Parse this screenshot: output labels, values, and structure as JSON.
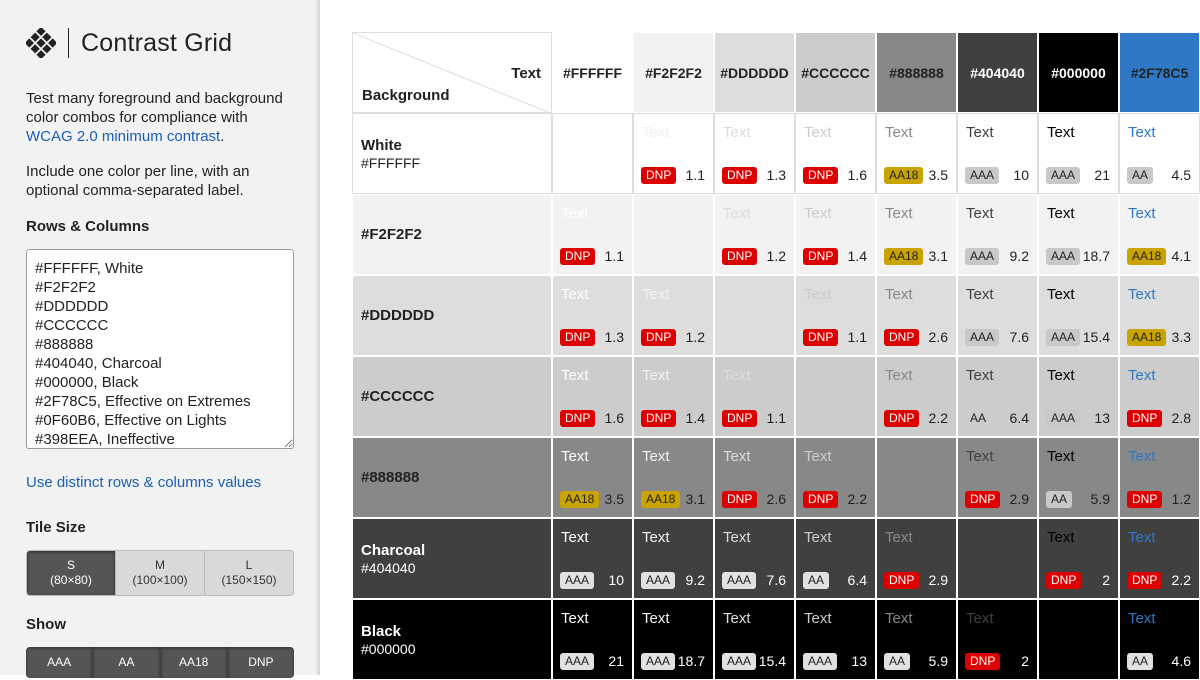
{
  "app": {
    "title": "Contrast Grid",
    "intro_text": "Test many foreground and background color combos for compliance with ",
    "intro_link": "WCAG 2.0 minimum contrast",
    "intro_end": ".",
    "note": "Include one color per line, with an optional comma-separated label."
  },
  "controls": {
    "rows_label": "Rows & Columns",
    "rows_value": "#FFFFFF, White\n#F2F2F2\n#DDDDDD\n#CCCCCC\n#888888\n#404040, Charcoal\n#000000, Black\n#2F78C5, Effective on Extremes\n#0F60B6, Effective on Lights\n#398EEA, Ineffective",
    "distinct_link": "Use distinct rows & columns values",
    "tile_size_label": "Tile Size",
    "tile_sizes": [
      {
        "name": "S",
        "dim": "(80×80)",
        "active": true
      },
      {
        "name": "M",
        "dim": "(100×100)",
        "active": false
      },
      {
        "name": "L",
        "dim": "(150×150)",
        "active": false
      }
    ],
    "show_label": "Show",
    "show_options": [
      "AAA",
      "AA",
      "AA18",
      "DNP"
    ]
  },
  "grid": {
    "corner_text": "Text",
    "corner_bg": "Background",
    "sample_text": "Text",
    "columns": [
      {
        "hex": "#FFFFFF"
      },
      {
        "hex": "#F2F2F2"
      },
      {
        "hex": "#DDDDDD"
      },
      {
        "hex": "#CCCCCC"
      },
      {
        "hex": "#888888"
      },
      {
        "hex": "#404040"
      },
      {
        "hex": "#000000"
      },
      {
        "hex": "#2F78C5"
      }
    ],
    "rows": [
      {
        "label": "White",
        "hex": "#FFFFFF",
        "show_hex": true
      },
      {
        "label": "",
        "hex": "#F2F2F2",
        "show_hex": false
      },
      {
        "label": "",
        "hex": "#DDDDDD",
        "show_hex": false
      },
      {
        "label": "",
        "hex": "#CCCCCC",
        "show_hex": false
      },
      {
        "label": "",
        "hex": "#888888",
        "show_hex": false
      },
      {
        "label": "Charcoal",
        "hex": "#404040",
        "show_hex": true
      },
      {
        "label": "Black",
        "hex": "#000000",
        "show_hex": true
      }
    ],
    "cells": [
      [
        null,
        {
          "badge": "DNP",
          "ratio": "1.1"
        },
        {
          "badge": "DNP",
          "ratio": "1.3"
        },
        {
          "badge": "DNP",
          "ratio": "1.6"
        },
        {
          "badge": "AA18",
          "ratio": "3.5"
        },
        {
          "badge": "AAA",
          "ratio": "10"
        },
        {
          "badge": "AAA",
          "ratio": "21"
        },
        {
          "badge": "AA",
          "ratio": "4.5"
        }
      ],
      [
        {
          "badge": "DNP",
          "ratio": "1.1"
        },
        null,
        {
          "badge": "DNP",
          "ratio": "1.2"
        },
        {
          "badge": "DNP",
          "ratio": "1.4"
        },
        {
          "badge": "AA18",
          "ratio": "3.1"
        },
        {
          "badge": "AAA",
          "ratio": "9.2"
        },
        {
          "badge": "AAA",
          "ratio": "18.7"
        },
        {
          "badge": "AA18",
          "ratio": "4.1"
        }
      ],
      [
        {
          "badge": "DNP",
          "ratio": "1.3"
        },
        {
          "badge": "DNP",
          "ratio": "1.2"
        },
        null,
        {
          "badge": "DNP",
          "ratio": "1.1"
        },
        {
          "badge": "DNP",
          "ratio": "2.6"
        },
        {
          "badge": "AAA",
          "ratio": "7.6"
        },
        {
          "badge": "AAA",
          "ratio": "15.4"
        },
        {
          "badge": "AA18",
          "ratio": "3.3"
        }
      ],
      [
        {
          "badge": "DNP",
          "ratio": "1.6"
        },
        {
          "badge": "DNP",
          "ratio": "1.4"
        },
        {
          "badge": "DNP",
          "ratio": "1.1"
        },
        null,
        {
          "badge": "DNP",
          "ratio": "2.2"
        },
        {
          "badge": "AA",
          "ratio": "6.4"
        },
        {
          "badge": "AAA",
          "ratio": "13"
        },
        {
          "badge": "DNP",
          "ratio": "2.8"
        }
      ],
      [
        {
          "badge": "AA18",
          "ratio": "3.5"
        },
        {
          "badge": "AA18",
          "ratio": "3.1"
        },
        {
          "badge": "DNP",
          "ratio": "2.6"
        },
        {
          "badge": "DNP",
          "ratio": "2.2"
        },
        null,
        {
          "badge": "DNP",
          "ratio": "2.9"
        },
        {
          "badge": "AA",
          "ratio": "5.9"
        },
        {
          "badge": "DNP",
          "ratio": "1.2"
        }
      ],
      [
        {
          "badge": "AAA",
          "ratio": "10"
        },
        {
          "badge": "AAA",
          "ratio": "9.2"
        },
        {
          "badge": "AAA",
          "ratio": "7.6"
        },
        {
          "badge": "AA",
          "ratio": "6.4"
        },
        {
          "badge": "DNP",
          "ratio": "2.9"
        },
        null,
        {
          "badge": "DNP",
          "ratio": "2"
        },
        {
          "badge": "DNP",
          "ratio": "2.2"
        }
      ],
      [
        {
          "badge": "AAA",
          "ratio": "21"
        },
        {
          "badge": "AAA",
          "ratio": "18.7"
        },
        {
          "badge": "AAA",
          "ratio": "15.4"
        },
        {
          "badge": "AAA",
          "ratio": "13"
        },
        {
          "badge": "AA",
          "ratio": "5.9"
        },
        {
          "badge": "DNP",
          "ratio": "2"
        },
        null,
        {
          "badge": "AA",
          "ratio": "4.6"
        }
      ]
    ]
  },
  "colors": {
    "link": "#1a5fb4",
    "dnp": "#dd0000",
    "aa18": "#c9a400",
    "aa_light": "#c8c8c8",
    "aa_dark": "#e1e1e1"
  }
}
